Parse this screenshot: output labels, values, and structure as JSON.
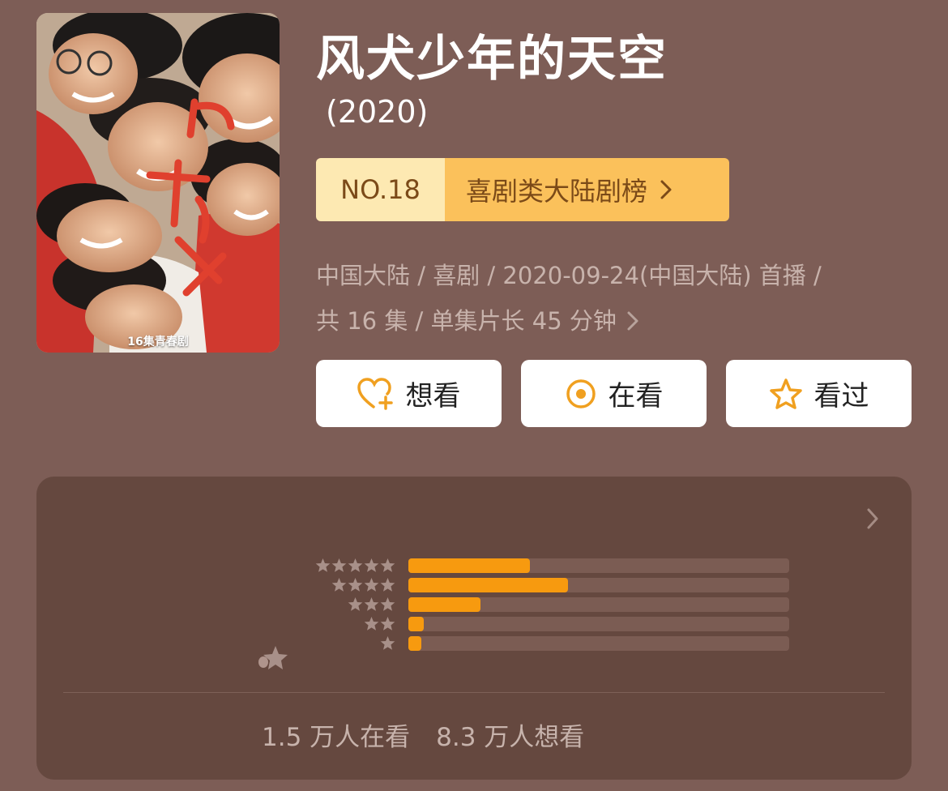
{
  "poster": {
    "caption": "16集青春剧",
    "art_title": "风犬少年的天空"
  },
  "title": "风犬少年的天空",
  "year": "(2020)",
  "rank": {
    "number": "NO.18",
    "category": "喜剧类大陆剧榜"
  },
  "meta": {
    "line1": "中国大陆 / 喜剧 / 2020-09-24(中国大陆) 首播 /",
    "line2": "共 16 集 / 单集片长 45 分钟"
  },
  "actions": {
    "want": "想看",
    "watching": "在看",
    "watched": "看过"
  },
  "rating": {
    "distribution": [
      {
        "stars": 5,
        "fraction": 0.32
      },
      {
        "stars": 4,
        "fraction": 0.42
      },
      {
        "stars": 3,
        "fraction": 0.19
      },
      {
        "stars": 2,
        "fraction": 0.04
      },
      {
        "stars": 1,
        "fraction": 0.035
      }
    ],
    "watching_count": "1.5 万人在看",
    "want_count": "8.3 万人想看"
  },
  "colors": {
    "background": "#7d5d56",
    "panel": "#65483f",
    "bar_fill": "#f79a0f",
    "icon_orange": "#f0a020"
  }
}
